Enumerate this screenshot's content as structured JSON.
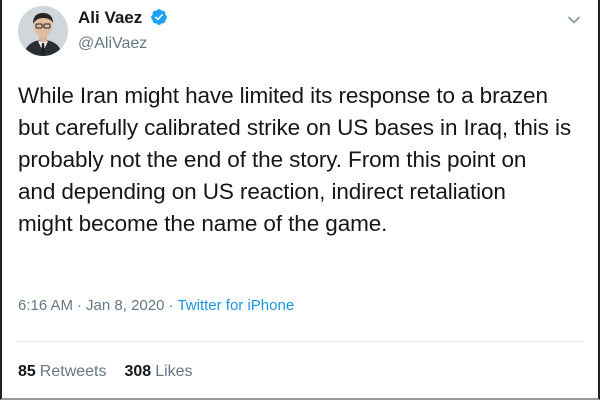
{
  "tweet": {
    "author": {
      "display_name": "Ali Vaez",
      "handle": "@AliVaez",
      "verified": true
    },
    "text": "While Iran might have limited its response to a brazen\nbut carefully calibrated strike on US bases in Iraq, this is\nprobably not the end of the story. From this point on\nand depending on US reaction, indirect retaliation\nmight become the name of the game.",
    "time": "6:16 AM",
    "date": "Jan 8, 2020",
    "separator": "·",
    "source": "Twitter for iPhone",
    "stats": {
      "retweets_count": "85",
      "retweets_label": "Retweets",
      "likes_count": "308",
      "likes_label": "Likes"
    }
  },
  "colors": {
    "text_primary": "#14171a",
    "text_secondary": "#657786",
    "link": "#1b95e0",
    "verified_badge": "#1da1f2",
    "divider": "#e1e8ed"
  },
  "icons": {
    "verified": "verified-badge-icon",
    "caret": "chevron-down-icon",
    "avatar": "profile-photo"
  }
}
